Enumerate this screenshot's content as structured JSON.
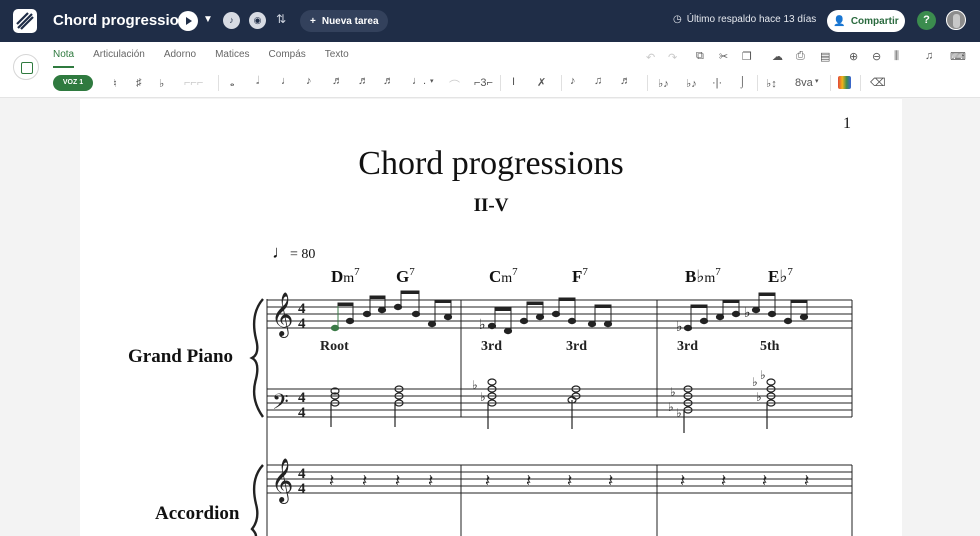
{
  "app": {
    "document_title": "Chord progressions",
    "new_task_label": "Nueva tarea",
    "backup_text": "Último respaldo hace 13 días",
    "share_label": "Compartir",
    "help_label": "?"
  },
  "toolbar": {
    "tabs": [
      {
        "label": "Nota",
        "active": true
      },
      {
        "label": "Articulación",
        "active": false
      },
      {
        "label": "Adorno",
        "active": false
      },
      {
        "label": "Matices",
        "active": false
      },
      {
        "label": "Compás",
        "active": false
      },
      {
        "label": "Texto",
        "active": false
      }
    ],
    "voice_label": "VOZ 1",
    "accent_color": "#2f7a3f"
  },
  "score": {
    "page_number": "1",
    "title": "Chord progressions",
    "subtitle": "II-V",
    "tempo": "= 80",
    "time_signature": "4/4",
    "chords": [
      {
        "root": "D",
        "quality": "m",
        "ext": "7"
      },
      {
        "root": "G",
        "quality": "",
        "ext": "7"
      },
      {
        "root": "C",
        "quality": "m",
        "ext": "7"
      },
      {
        "root": "F",
        "quality": "",
        "ext": "7"
      },
      {
        "root": "B♭",
        "quality": "m",
        "ext": "7"
      },
      {
        "root": "E♭",
        "quality": "",
        "ext": "7"
      }
    ],
    "lyrics": [
      "Root",
      "3rd",
      "3rd",
      "3rd",
      "5th"
    ],
    "instruments": [
      "Grand Piano",
      "Accordion"
    ]
  }
}
